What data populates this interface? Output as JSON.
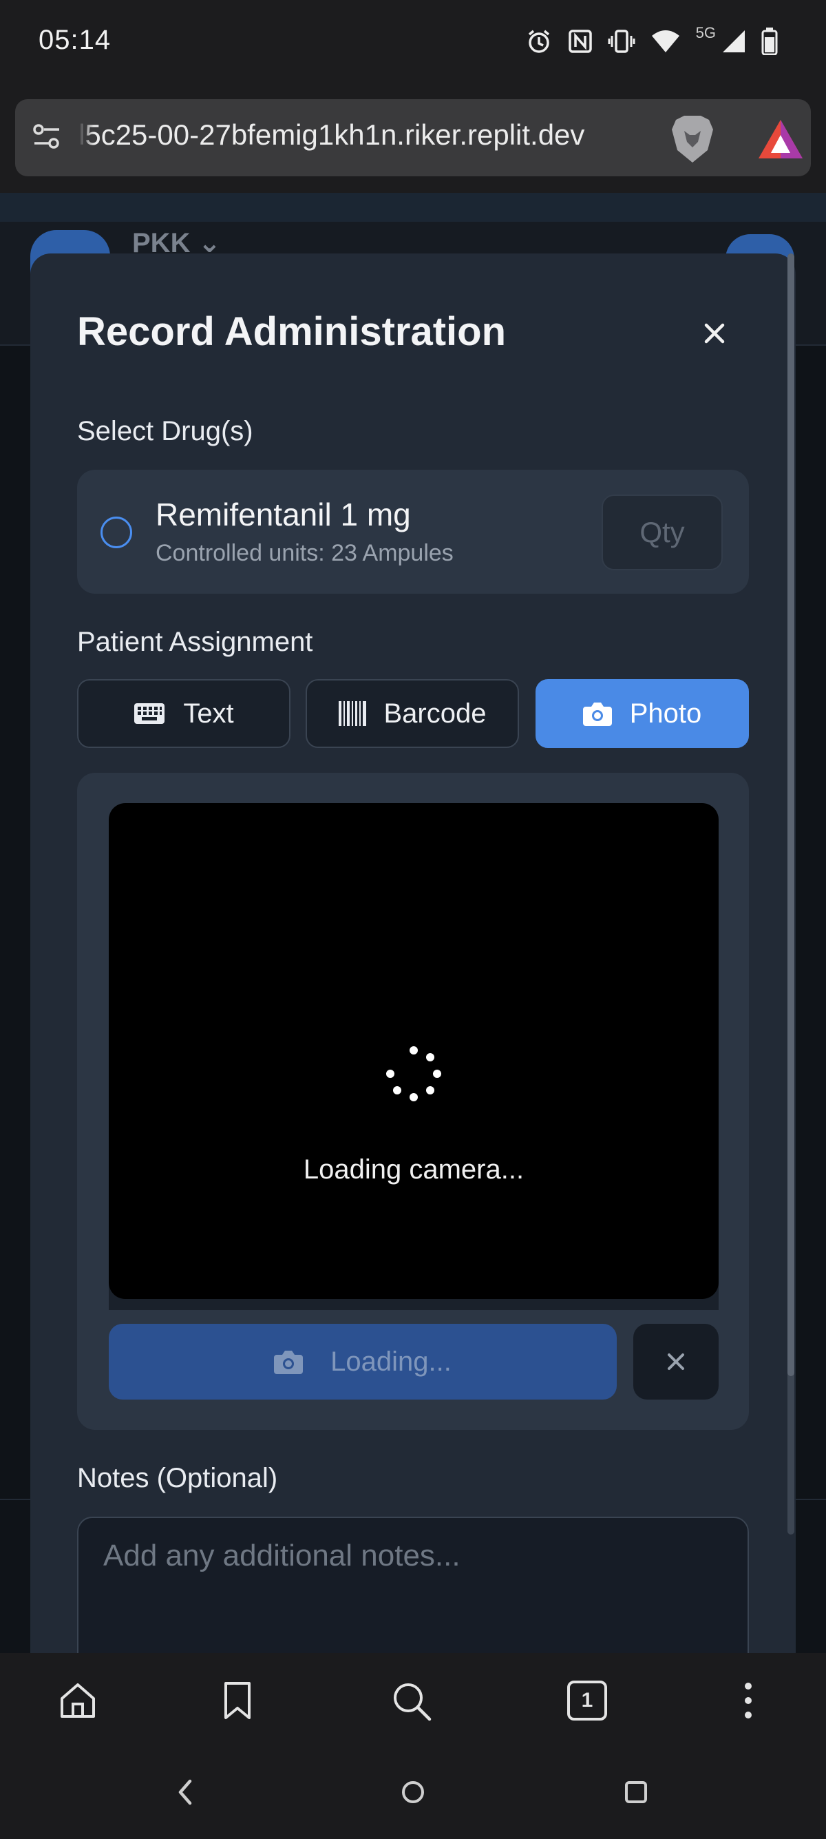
{
  "status_bar": {
    "time": "05:14",
    "network": "5G"
  },
  "browser": {
    "url": "l5c25-00-27bfemig1kh1n.riker.replit.dev",
    "tab_count": "1"
  },
  "background": {
    "title": "PKK"
  },
  "modal": {
    "title": "Record Administration",
    "select_drugs_label": "Select Drug(s)",
    "drug": {
      "name": "Remifentanil 1 mg",
      "subtitle": "Controlled units: 23 Ampules",
      "qty_placeholder": "Qty"
    },
    "patient_assignment_label": "Patient Assignment",
    "modes": [
      {
        "label": "Text",
        "icon": "keyboard-icon",
        "active": false
      },
      {
        "label": "Barcode",
        "icon": "barcode-icon",
        "active": false
      },
      {
        "label": "Photo",
        "icon": "camera-icon",
        "active": true
      }
    ],
    "camera": {
      "status": "Loading camera...",
      "capture_label": "Loading..."
    },
    "notes_label": "Notes (Optional)",
    "notes_placeholder": "Add any additional notes..."
  },
  "colors": {
    "accent": "#4a8ae6",
    "modal_bg": "#222a36",
    "card_bg": "#2c3644"
  }
}
